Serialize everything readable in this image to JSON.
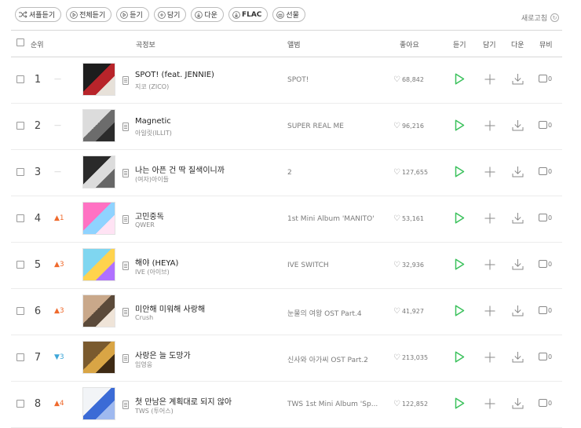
{
  "toolbar": {
    "shuffle": "셔플듣기",
    "play_all": "전체듣기",
    "play": "듣기",
    "add": "담기",
    "download": "다운",
    "flac": "FLAC",
    "gift": "선물",
    "refresh": "새로고침"
  },
  "header": {
    "rank": "순위",
    "song_info": "곡정보",
    "album": "앨범",
    "likes": "좋아요",
    "play": "듣기",
    "add": "담기",
    "download": "다운",
    "mv": "뮤비"
  },
  "rows": [
    {
      "rank": "1",
      "change": "—",
      "change_type": "same",
      "title": "SPOT! (feat. JENNIE)",
      "artist": "지코 (ZICO)",
      "album": "SPOT!",
      "likes": "68,842",
      "mv": "0"
    },
    {
      "rank": "2",
      "change": "—",
      "change_type": "same",
      "title": "Magnetic",
      "artist": "아일릿(ILLIT)",
      "album": "SUPER REAL ME",
      "likes": "96,216",
      "mv": "0"
    },
    {
      "rank": "3",
      "change": "—",
      "change_type": "same",
      "title": "나는 아픈 건 딱 질색이니까",
      "artist": "(여자)아이들",
      "album": "2",
      "likes": "127,655",
      "mv": "0"
    },
    {
      "rank": "4",
      "change": "▲1",
      "change_type": "up",
      "title": "고민중독",
      "artist": "QWER",
      "album": "1st Mini Album 'MANITO'",
      "likes": "53,161",
      "mv": "0"
    },
    {
      "rank": "5",
      "change": "▲3",
      "change_type": "up",
      "title": "해야 (HEYA)",
      "artist": "IVE (아이브)",
      "album": "IVE SWITCH",
      "likes": "32,936",
      "mv": "0"
    },
    {
      "rank": "6",
      "change": "▲3",
      "change_type": "up",
      "title": "미안해 미워해 사랑해",
      "artist": "Crush",
      "album": "눈물의 여왕 OST Part.4",
      "likes": "41,927",
      "mv": "0"
    },
    {
      "rank": "7",
      "change": "▼3",
      "change_type": "down",
      "title": "사랑은 늘 도망가",
      "artist": "임영웅",
      "album": "신사와 아가씨 OST Part.2",
      "likes": "213,035",
      "mv": "0"
    },
    {
      "rank": "8",
      "change": "▲4",
      "change_type": "up",
      "title": "첫 만남은 계획대로 되지 않아",
      "artist": "TWS (투어스)",
      "album": "TWS 1st Mini Album 'Sp...",
      "likes": "122,852",
      "mv": "0"
    }
  ],
  "colors": {
    "play_icon": "#3bc15c",
    "rank_up": "#ef6a2d",
    "rank_down": "#3ea6d8",
    "rank_same": "#c4c4c4"
  }
}
